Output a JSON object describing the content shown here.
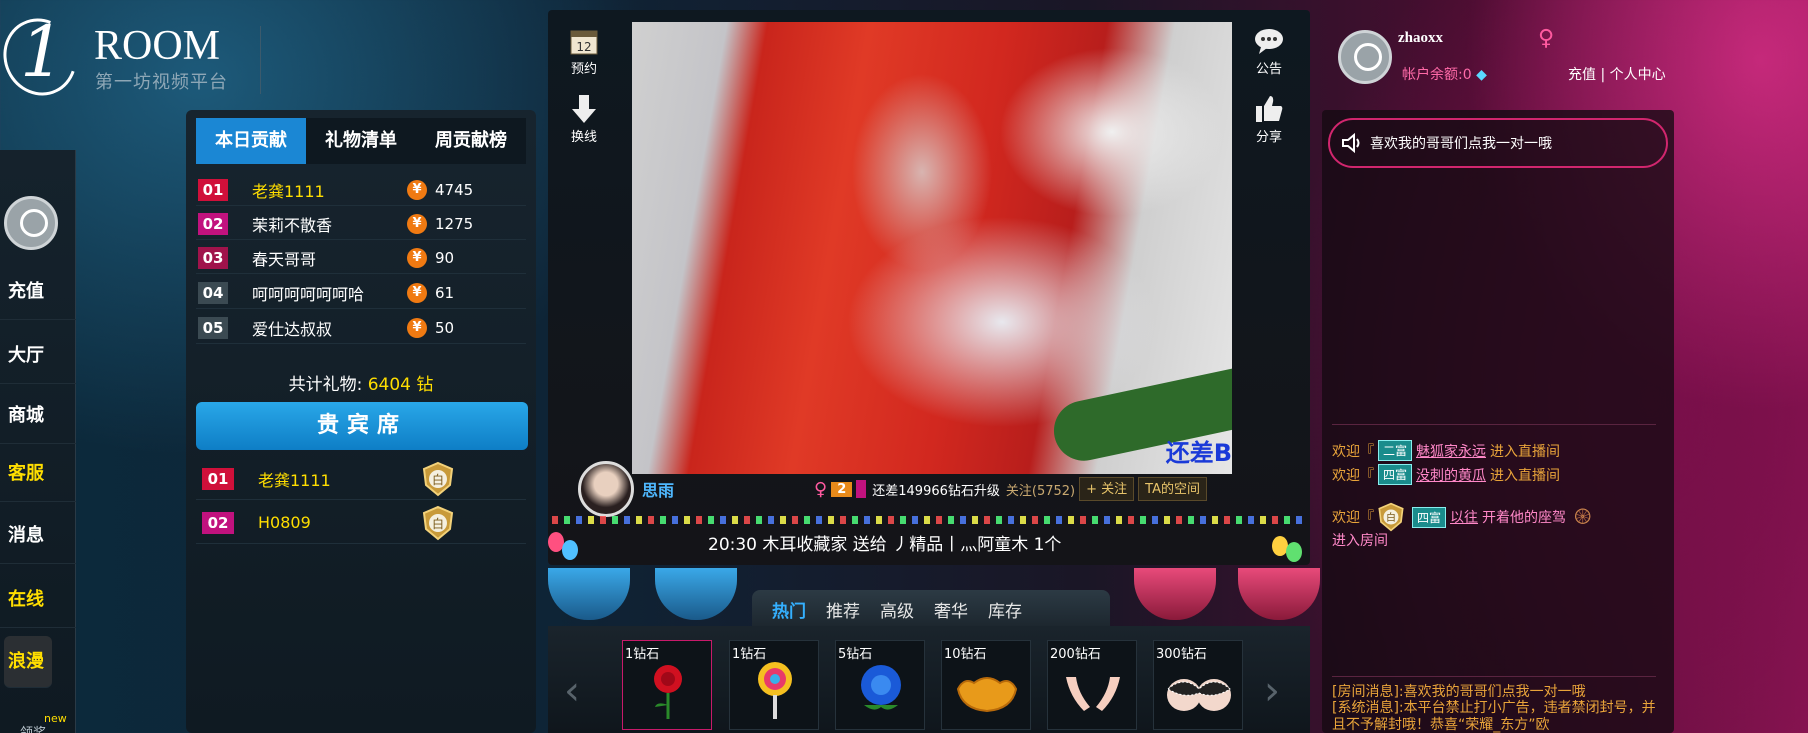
{
  "brand": {
    "one": "1",
    "room": "ROOM",
    "subtitle": "第一坊视频平台"
  },
  "leftnav": {
    "items": [
      {
        "label": "充值",
        "color": "#ffffff"
      },
      {
        "label": "大厅",
        "color": "#ffffff"
      },
      {
        "label": "商城",
        "color": "#ffffff"
      },
      {
        "label": "客服",
        "color": "#ffde00"
      },
      {
        "label": "消息",
        "color": "#ffffff"
      },
      {
        "label": "在线",
        "color": "#ffde00"
      },
      {
        "label": "浪漫",
        "color": "#ffde00"
      }
    ],
    "new_badge": "new",
    "reward": "领奖"
  },
  "ranking": {
    "tabs": [
      "本日贡献",
      "礼物清单",
      "周贡献榜"
    ],
    "rows": [
      {
        "num": "01",
        "name": "老龚1111",
        "coin": "¥",
        "value": "4745"
      },
      {
        "num": "02",
        "name": "茉莉不散香",
        "coin": "¥",
        "value": "1275"
      },
      {
        "num": "03",
        "name": "春天哥哥",
        "coin": "¥",
        "value": "90"
      },
      {
        "num": "04",
        "name": "呵呵呵呵呵呵哈",
        "coin": "¥",
        "value": "61"
      },
      {
        "num": "05",
        "name": "爱仕达叔叔",
        "coin": "¥",
        "value": "50"
      }
    ],
    "total_label": "共计礼物:",
    "total_value": "6404 钻"
  },
  "vip": {
    "title": "贵宾席",
    "rows": [
      {
        "num": "01",
        "name": "老龚1111",
        "badge": "白"
      },
      {
        "num": "02",
        "name": "H0809",
        "badge": "白"
      }
    ]
  },
  "video_side": {
    "calendar_num": "12",
    "reserve": "预约",
    "switch_line": "换线",
    "notice": "公告",
    "share": "分享"
  },
  "video": {
    "overlay": "还差B"
  },
  "anchor": {
    "name": "思雨",
    "level": "2",
    "upgrade": "还差149966钻石升级",
    "follow_count": "关注(5752)",
    "follow_btn": "+ 关注",
    "space_btn": "TA的空间"
  },
  "ticker": "20:30  木耳收藏家 送给  丿精品丨灬阿童木    1个",
  "gift_tabs": [
    "热门",
    "推荐",
    "高级",
    "奢华",
    "库存"
  ],
  "gifts": [
    {
      "price": "1钻石",
      "icon": "rose"
    },
    {
      "price": "1钻石",
      "icon": "lollipop"
    },
    {
      "price": "5钻石",
      "icon": "blue-rose"
    },
    {
      "price": "10钻石",
      "icon": "gold-ingot"
    },
    {
      "price": "200钻石",
      "icon": "hands"
    },
    {
      "price": "300钻石",
      "icon": "bra"
    }
  ],
  "user": {
    "name": "zhaoxx",
    "gender": "♀",
    "balance": "帐户余额:0",
    "recharge": "充值",
    "center": "个人中心"
  },
  "notice_msg": "喜欢我的哥哥们点我一对一哦",
  "chat": {
    "line1": {
      "pre": "欢迎『",
      "badge": "二富",
      "user": "魅狐家永远",
      "post": "进入直播间"
    },
    "line2": {
      "pre": "欢迎『",
      "badge": "四富",
      "user": "没刺的黄瓜",
      "post": "进入直播间"
    },
    "line3": {
      "pre": "欢迎『",
      "badge_w": "白",
      "badge": "四富",
      "user": "以往",
      "post": "开着他的座驾",
      "post2": "进入房间"
    }
  },
  "system": {
    "room_msg": "[房间消息]:喜欢我的哥哥们点我一对一哦",
    "sys_msg": "[系统消息]:本平台禁止打小广告，违者禁闭封号，并且不予解封哦！恭喜“荣耀_东方”欧"
  },
  "colors": {
    "accent_blue": "#1b87d4",
    "gold": "#ffde00",
    "pink": "#d1266e"
  }
}
